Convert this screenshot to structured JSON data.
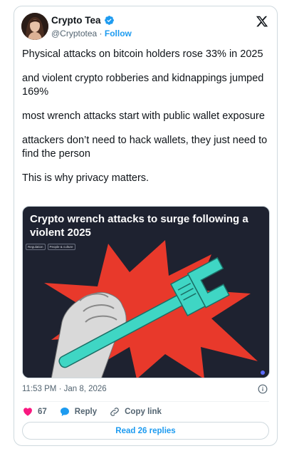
{
  "author": {
    "display_name": "Crypto Tea",
    "handle": "@Cryptotea",
    "separator": " · ",
    "follow_label": "Follow"
  },
  "tweet": {
    "paragraphs": [
      "Physical attacks on bitcoin holders rose 33% in 2025",
      "and violent crypto robberies and kidnappings jumped 169%",
      "most wrench attacks start with public wallet exposure",
      "attackers don’t need to hack wallets, they just need to find the person",
      "This is why privacy matters."
    ]
  },
  "media": {
    "headline": "Crypto wrench attacks to surge following a violent 2025",
    "tags": [
      "Regulation",
      "People & culture"
    ]
  },
  "meta": {
    "timestamp": "11:53 PM · Jan 8, 2026"
  },
  "actions": {
    "like_count": "67",
    "reply_label": "Reply",
    "copy_link_label": "Copy link"
  },
  "replies_button": "Read 26 replies",
  "colors": {
    "accent": "#1d9bf0",
    "like": "#f91880",
    "wrench": "#3fd6c4",
    "burst": "#e8392b",
    "media_bg": "#1e2230"
  },
  "icons": [
    "verified-badge-icon",
    "x-logo-icon",
    "info-icon",
    "heart-icon",
    "reply-bubble-icon",
    "link-icon"
  ]
}
